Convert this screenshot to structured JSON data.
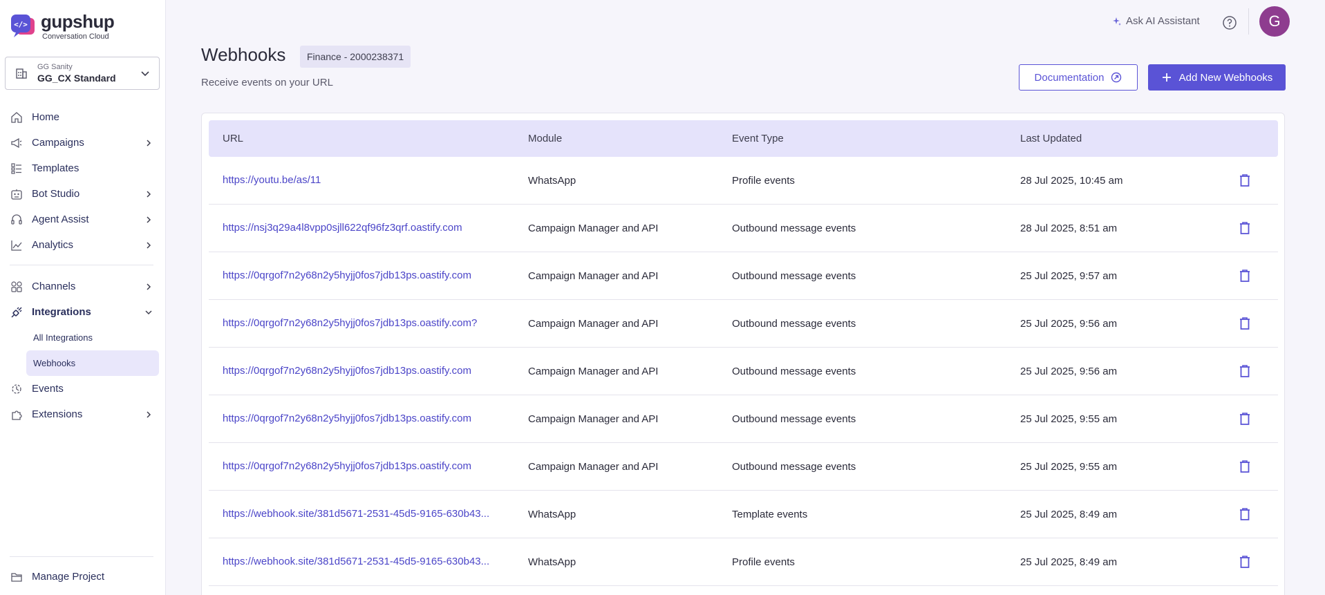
{
  "brand": {
    "name": "gupshup",
    "tagline": "Conversation Cloud"
  },
  "project_selector": {
    "org": "GG Sanity",
    "name": "GG_CX Standard"
  },
  "nav": {
    "home": "Home",
    "campaigns": "Campaigns",
    "templates": "Templates",
    "bot_studio": "Bot Studio",
    "agent_assist": "Agent Assist",
    "analytics": "Analytics",
    "channels": "Channels",
    "integrations": "Integrations",
    "all_integrations": "All Integrations",
    "webhooks": "Webhooks",
    "events": "Events",
    "extensions": "Extensions",
    "manage_project": "Manage Project"
  },
  "topbar": {
    "ai_label": "Ask AI Assistant",
    "avatar_initial": "G"
  },
  "header": {
    "title": "Webhooks",
    "project_badge": "Finance - 2000238371",
    "subtitle": "Receive events on your URL",
    "doc_button": "Documentation",
    "add_button": "Add New Webhooks"
  },
  "table": {
    "columns": [
      "URL",
      "Module",
      "Event Type",
      "Last Updated"
    ],
    "rows": [
      {
        "url": "https://youtu.be/as/11",
        "module": "WhatsApp",
        "event": "Profile events",
        "updated": "28 Jul 2025, 10:45 am"
      },
      {
        "url": "https://nsj3q29a4l8vpp0sjll622qf96fz3qrf.oastify.com",
        "module": "Campaign Manager and API",
        "event": "Outbound message events",
        "updated": "28 Jul 2025, 8:51 am"
      },
      {
        "url": "https://0qrgof7n2y68n2y5hyjj0fos7jdb13ps.oastify.com",
        "module": "Campaign Manager and API",
        "event": "Outbound message events",
        "updated": "25 Jul 2025, 9:57 am"
      },
      {
        "url": "https://0qrgof7n2y68n2y5hyjj0fos7jdb13ps.oastify.com?",
        "module": "Campaign Manager and API",
        "event": "Outbound message events",
        "updated": "25 Jul 2025, 9:56 am"
      },
      {
        "url": "https://0qrgof7n2y68n2y5hyjj0fos7jdb13ps.oastify.com",
        "module": "Campaign Manager and API",
        "event": "Outbound message events",
        "updated": "25 Jul 2025, 9:56 am"
      },
      {
        "url": "https://0qrgof7n2y68n2y5hyjj0fos7jdb13ps.oastify.com",
        "module": "Campaign Manager and API",
        "event": "Outbound message events",
        "updated": "25 Jul 2025, 9:55 am"
      },
      {
        "url": "https://0qrgof7n2y68n2y5hyjj0fos7jdb13ps.oastify.com",
        "module": "Campaign Manager and API",
        "event": "Outbound message events",
        "updated": "25 Jul 2025, 9:55 am"
      },
      {
        "url": "https://webhook.site/381d5671-2531-45d5-9165-630b43...",
        "module": "WhatsApp",
        "event": "Template events",
        "updated": "25 Jul 2025, 8:49 am"
      },
      {
        "url": "https://webhook.site/381d5671-2531-45d5-9165-630b43...",
        "module": "WhatsApp",
        "event": "Profile events",
        "updated": "25 Jul 2025, 8:49 am"
      }
    ]
  },
  "colors": {
    "accent": "#5a53d6",
    "link": "#4b45c8",
    "header_row": "#e5e3fb",
    "avatar": "#8e3c8f",
    "active_nav": "#e9e7fb"
  }
}
